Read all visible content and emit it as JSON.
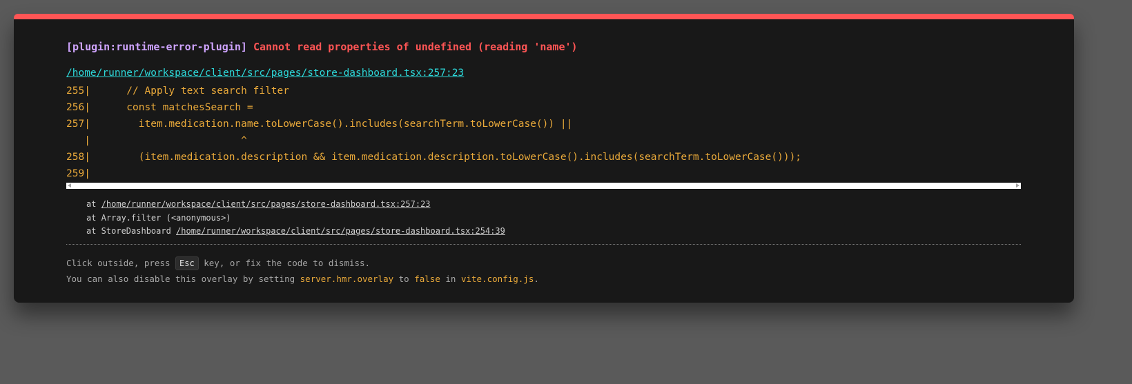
{
  "error": {
    "plugin": "[plugin:runtime-error-plugin]",
    "message": "Cannot read properties of undefined (reading 'name')",
    "file": "/home/runner/workspace/client/src/pages/store-dashboard.tsx:257:23"
  },
  "code_frame": [
    "255|      // Apply text search filter",
    "256|      const matchesSearch = ",
    "257|        item.medication.name.toLowerCase().includes(searchTerm.toLowerCase()) ||",
    "   |                         ^",
    "258|        (item.medication.description && item.medication.description.toLowerCase().includes(searchTerm.toLowerCase()));",
    "259|"
  ],
  "stack": {
    "line1_prefix": "at ",
    "line1_link": "/home/runner/workspace/client/src/pages/store-dashboard.tsx:257:23",
    "line2": "at Array.filter (<anonymous>)",
    "line3_prefix": "at StoreDashboard ",
    "line3_link": "/home/runner/workspace/client/src/pages/store-dashboard.tsx:254:39"
  },
  "tip": {
    "line1_before": "Click outside, press ",
    "key": "Esc",
    "line1_after": " key, or fix the code to dismiss.",
    "line2_before": "You can also disable this overlay by setting ",
    "setting": "server.hmr.overlay",
    "line2_to": " to ",
    "value": "false",
    "line2_in": " in ",
    "config_file": "vite.config.js",
    "line2_end": "."
  },
  "colors": {
    "accent_red": "#ff5555",
    "plugin_purple": "#cfa4ff",
    "link_cyan": "#2dd9da",
    "code_yellow": "#e9a93a",
    "card_bg": "#181818",
    "backdrop": "#5a5a5a"
  }
}
